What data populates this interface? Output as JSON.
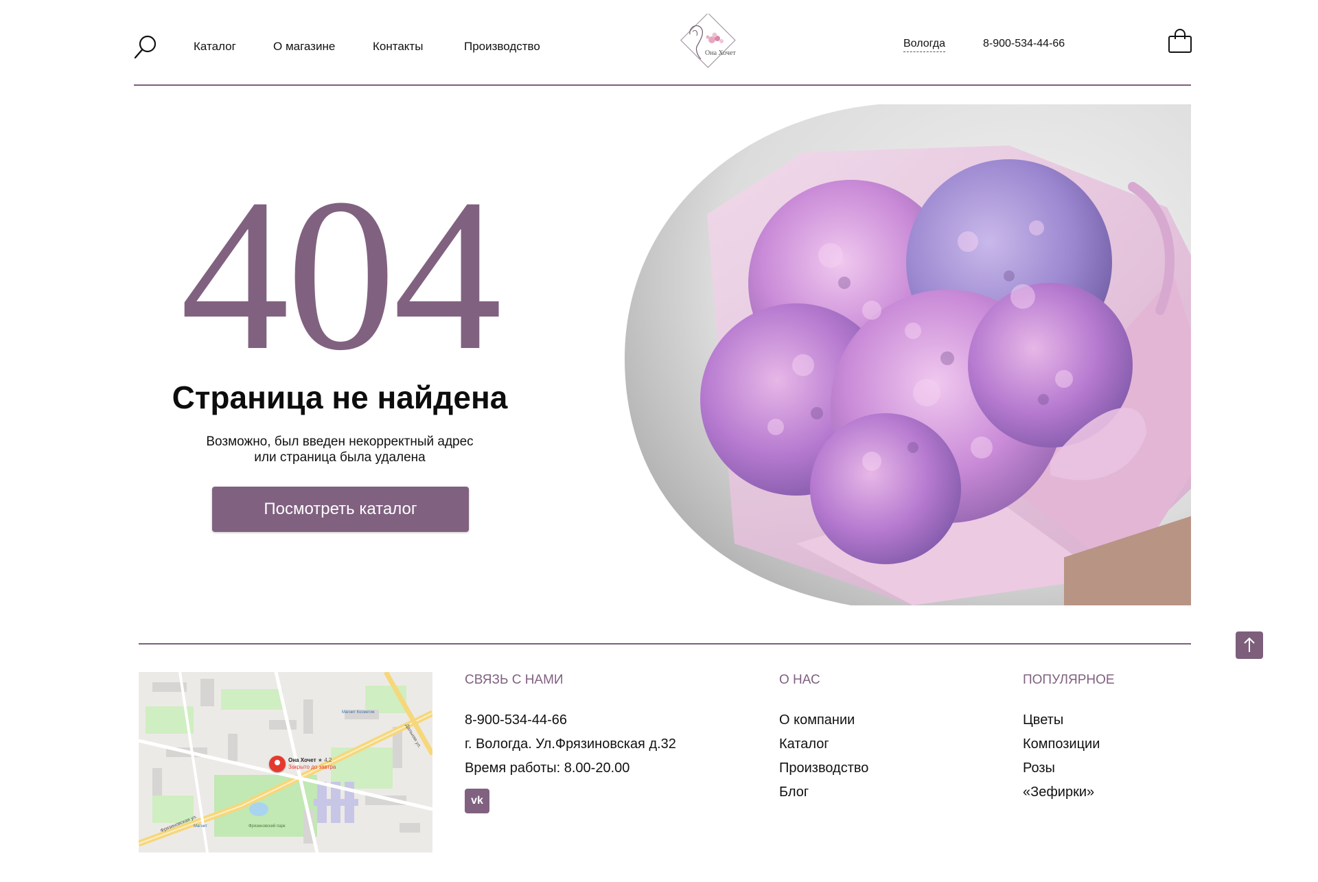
{
  "header": {
    "nav": [
      {
        "label": "Каталог"
      },
      {
        "label": "О магазине"
      },
      {
        "label": "Контакты"
      },
      {
        "label": "Производство"
      }
    ],
    "logo_text": "Она Хочет",
    "city": "Вологда",
    "phone": "8-900-534-44-66",
    "icons": {
      "search": "search-icon",
      "cart": "shopping-bag-icon"
    }
  },
  "hero": {
    "code": "404",
    "title": "Страница не найдена",
    "subtitle_line1": "Возможно, был введен некорректный адрес",
    "subtitle_line2": "или страница была удалена",
    "button": "Посмотреть каталог",
    "image": "hydrangea-bouquet-image"
  },
  "footer": {
    "contact": {
      "title": "СВЯЗЬ С НАМИ",
      "phone": "8-900-534-44-66",
      "address": "г. Вологда. Ул.Фрязиновская д.32",
      "hours": "Время работы: 8.00-20.00",
      "social": "vk-icon"
    },
    "about": {
      "title": "О НАС",
      "items": [
        "О компании",
        "Каталог",
        "Производство",
        "Блог"
      ]
    },
    "popular": {
      "title": "ПОПУЛЯРНОЕ",
      "items": [
        "Цветы",
        "Композиции",
        "Розы",
        "«Зефирки»"
      ]
    },
    "map": {
      "place_name": "Она Хочет",
      "rating": "★ 4,2",
      "status": "Закрыто до завтра",
      "labels": [
        "Фрязиновская ул.",
        "Дальняя ул.",
        "Фрязиновский парк",
        "Магнит",
        "Магнит Косметик"
      ]
    }
  },
  "colors": {
    "accent": "#806180",
    "text": "#111111",
    "background": "#ffffff"
  }
}
